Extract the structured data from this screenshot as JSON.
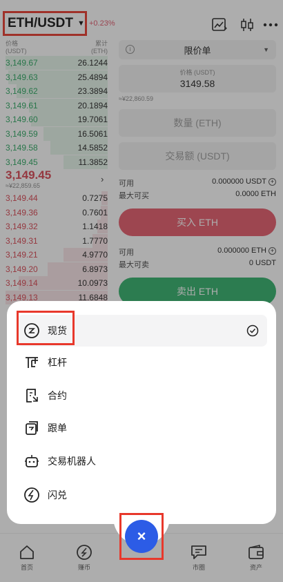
{
  "header": {
    "pair": "ETH/USDT",
    "change": "+0.23%",
    "chart_icon": "trend-chart-icon",
    "candle_icon": "candlestick-icon",
    "more_icon": "more-dots-icon"
  },
  "orderbook": {
    "price_header": "价格",
    "price_unit": "(USDT)",
    "total_header": "累计",
    "total_unit": "(ETH)",
    "asks": [
      {
        "price": "3,149.67",
        "qty": "26.1244",
        "depth": 1.0
      },
      {
        "price": "3,149.63",
        "qty": "25.4894",
        "depth": 0.97
      },
      {
        "price": "3,149.62",
        "qty": "23.3894",
        "depth": 0.89
      },
      {
        "price": "3,149.61",
        "qty": "20.1894",
        "depth": 0.77
      },
      {
        "price": "3,149.60",
        "qty": "19.7061",
        "depth": 0.75
      },
      {
        "price": "3,149.59",
        "qty": "16.5061",
        "depth": 0.63
      },
      {
        "price": "3,149.58",
        "qty": "14.5852",
        "depth": 0.56
      },
      {
        "price": "3,149.45",
        "qty": "11.3852",
        "depth": 0.43
      }
    ],
    "last_price": "3,149.45",
    "last_price_cny": "≈¥22,859.65",
    "bids": [
      {
        "price": "3,149.44",
        "qty": "0.7275",
        "depth": 0.06
      },
      {
        "price": "3,149.36",
        "qty": "0.7601",
        "depth": 0.07
      },
      {
        "price": "3,149.32",
        "qty": "1.1418",
        "depth": 0.1
      },
      {
        "price": "3,149.31",
        "qty": "1.7770",
        "depth": 0.15
      },
      {
        "price": "3,149.21",
        "qty": "4.9770",
        "depth": 0.43
      },
      {
        "price": "3,149.20",
        "qty": "6.8973",
        "depth": 0.59
      },
      {
        "price": "3,149.14",
        "qty": "10.0973",
        "depth": 0.87
      },
      {
        "price": "3,149.13",
        "qty": "11.6848",
        "depth": 1.0
      }
    ]
  },
  "trade": {
    "order_type": "限价单",
    "price_label": "价格 (USDT)",
    "price_value": "3149.58",
    "price_cny": "≈¥22,860.59",
    "qty_placeholder": "数量 (ETH)",
    "amount_placeholder": "交易额 (USDT)",
    "buy": {
      "avail_label": "可用",
      "avail_value": "0.000000 USDT",
      "max_label": "最大可买",
      "max_value": "0.0000 ETH",
      "button": "买入 ETH"
    },
    "sell": {
      "avail_label": "可用",
      "avail_value": "0.000000 ETH",
      "max_label": "最大可卖",
      "max_value": "0 USDT",
      "button": "卖出 ETH"
    }
  },
  "menu": {
    "items": [
      {
        "label": "现货",
        "icon": "spot-icon",
        "selected": true
      },
      {
        "label": "杠杆",
        "icon": "margin-icon"
      },
      {
        "label": "合约",
        "icon": "contract-icon"
      },
      {
        "label": "跟单",
        "icon": "copy-trade-icon"
      },
      {
        "label": "交易机器人",
        "icon": "bot-icon"
      },
      {
        "label": "闪兑",
        "icon": "flash-swap-icon"
      }
    ],
    "close_symbol": "×"
  },
  "nav": {
    "items": [
      {
        "label": "首页",
        "icon": "home-icon"
      },
      {
        "label": "赚币",
        "icon": "earn-icon"
      },
      {
        "label": "市圈",
        "icon": "feed-icon"
      },
      {
        "label": "资产",
        "icon": "wallet-icon"
      }
    ]
  },
  "colors": {
    "ask": "#2aa760",
    "bid": "#d9434f",
    "accent": "#2c5ce6",
    "highlight": "#e8382b"
  }
}
